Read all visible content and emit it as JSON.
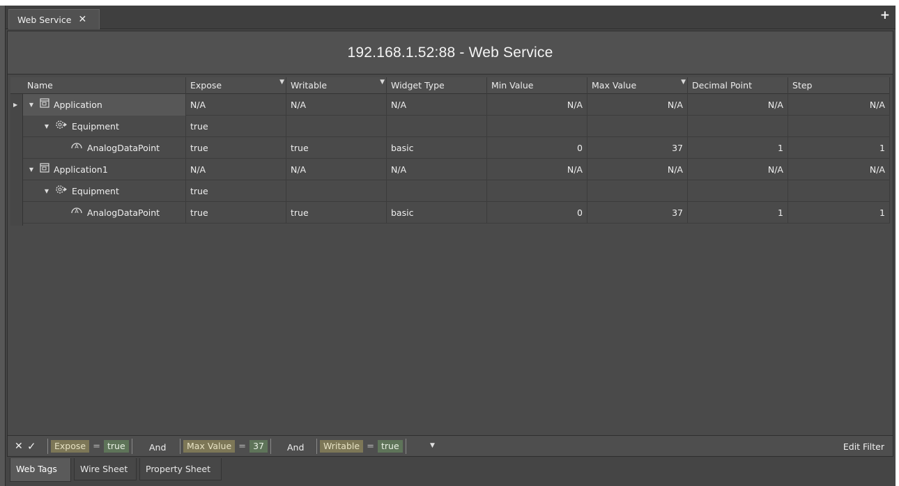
{
  "document_tab": {
    "label": "Web Service",
    "close_glyph": "✕"
  },
  "add_tab_glyph": "+",
  "header": {
    "title": "192.168.1.52:88 - Web Service"
  },
  "grid": {
    "columns": [
      {
        "label": "Name",
        "filtered": false
      },
      {
        "label": "Expose",
        "filtered": true
      },
      {
        "label": "Writable",
        "filtered": true
      },
      {
        "label": "Widget Type",
        "filtered": false
      },
      {
        "label": "Min Value",
        "filtered": false
      },
      {
        "label": "Max Value",
        "filtered": true
      },
      {
        "label": "Decimal Point",
        "filtered": false
      },
      {
        "label": "Step",
        "filtered": false
      }
    ],
    "rows": [
      {
        "level": 0,
        "icon": "application-icon",
        "expanded": true,
        "current": true,
        "name": "Application",
        "expose": "N/A",
        "writable": "N/A",
        "widget_type": "N/A",
        "min_value": "N/A",
        "max_value": "N/A",
        "decimal_point": "N/A",
        "step": "N/A"
      },
      {
        "level": 1,
        "icon": "equipment-gear-icon",
        "expanded": true,
        "current": false,
        "name": "Equipment",
        "expose": "true",
        "writable": "",
        "widget_type": "",
        "min_value": "",
        "max_value": "",
        "decimal_point": "",
        "step": ""
      },
      {
        "level": 2,
        "icon": "analog-datapoint-icon",
        "expanded": false,
        "current": false,
        "name": "AnalogDataPoint",
        "expose": "true",
        "writable": "true",
        "widget_type": "basic",
        "min_value": "0",
        "max_value": "37",
        "decimal_point": "1",
        "step": "1"
      },
      {
        "level": 0,
        "icon": "application-icon",
        "expanded": true,
        "current": false,
        "name": "Application1",
        "expose": "N/A",
        "writable": "N/A",
        "widget_type": "N/A",
        "min_value": "N/A",
        "max_value": "N/A",
        "decimal_point": "N/A",
        "step": "N/A"
      },
      {
        "level": 1,
        "icon": "equipment-gear-icon",
        "expanded": true,
        "current": false,
        "name": "Equipment",
        "expose": "true",
        "writable": "",
        "widget_type": "",
        "min_value": "",
        "max_value": "",
        "decimal_point": "",
        "step": ""
      },
      {
        "level": 2,
        "icon": "analog-datapoint-icon",
        "expanded": false,
        "current": false,
        "name": "AnalogDataPoint",
        "expose": "true",
        "writable": "true",
        "widget_type": "basic",
        "min_value": "0",
        "max_value": "37",
        "decimal_point": "1",
        "step": "1"
      }
    ]
  },
  "filter_bar": {
    "clear_glyph": "✕",
    "enable_glyph": "✓",
    "conditions": [
      {
        "field": "Expose",
        "operator": "=",
        "value": "true"
      },
      {
        "field": "Max Value",
        "operator": "=",
        "value": "37"
      },
      {
        "field": "Writable",
        "operator": "=",
        "value": "true"
      }
    ],
    "joiner": "And",
    "edit_label": "Edit Filter"
  },
  "view_tabs": [
    {
      "label": "Web Tags",
      "active": true
    },
    {
      "label": "Wire Sheet",
      "active": false
    },
    {
      "label": "Property Sheet",
      "active": false
    }
  ],
  "colors": {
    "background": "#454545",
    "field_chip": "#7d7757",
    "value_chip": "#5e7459"
  }
}
